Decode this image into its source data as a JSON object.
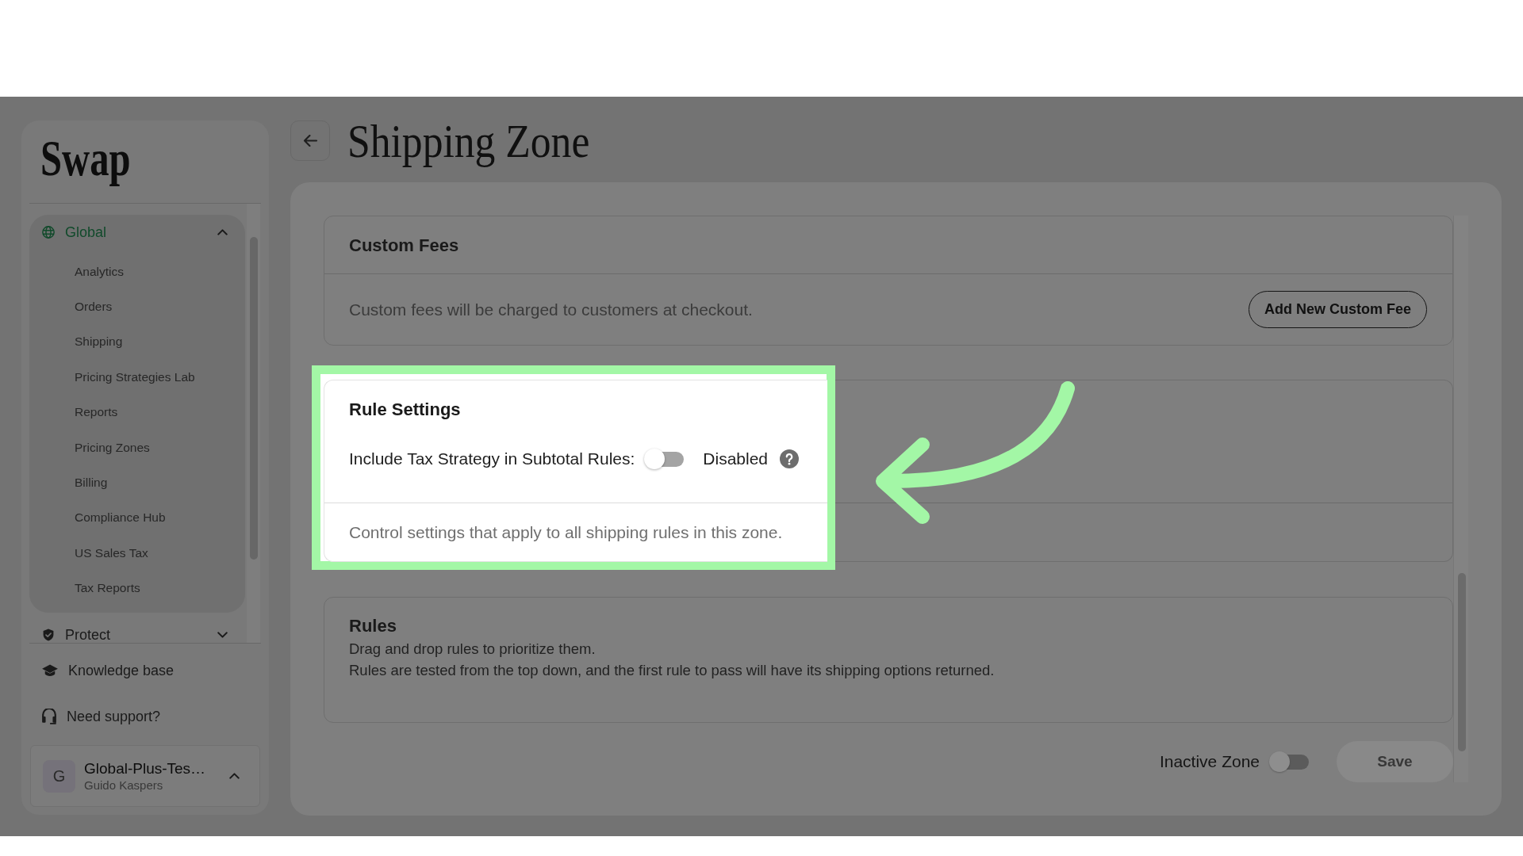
{
  "sidebar": {
    "logo": "Swap",
    "groups": [
      {
        "label": "Global",
        "selected": true,
        "expanded": true,
        "items": [
          "Analytics",
          "Orders",
          "Shipping",
          "Pricing Strategies Lab",
          "Reports",
          "Pricing Zones",
          "Billing",
          "Compliance Hub",
          "US Sales Tax",
          "Tax Reports"
        ]
      },
      {
        "label": "Protect",
        "selected": false,
        "expanded": false
      }
    ],
    "links": [
      "Knowledge base",
      "Need support?"
    ],
    "account": {
      "initial": "G",
      "name": "Global-Plus-Tes…",
      "user": "Guido Kaspers"
    }
  },
  "page": {
    "title": "Shipping Zone"
  },
  "sections": [
    {
      "kind": "custom_fees",
      "title": "Custom Fees",
      "description": "Custom fees will be charged to customers at checkout.",
      "button": "Add New Custom Fee"
    },
    {
      "kind": "rule_settings",
      "title": "Rule Settings",
      "highlighted": true,
      "setting": {
        "label": "Include Tax Strategy in Subtotal Rules:",
        "on": false,
        "status": "Disabled"
      },
      "description": "Control settings that apply to all shipping rules in this zone."
    },
    {
      "kind": "rules",
      "title": "Rules",
      "lines": [
        "Drag and drop rules to prioritize them.",
        "Rules are tested from the top down, and the first rule to pass will have its shipping options returned."
      ]
    }
  ],
  "footer": {
    "toggle": {
      "label": "Inactive Zone",
      "on": false
    },
    "save_button": {
      "label": "Save",
      "disabled": true
    }
  }
}
